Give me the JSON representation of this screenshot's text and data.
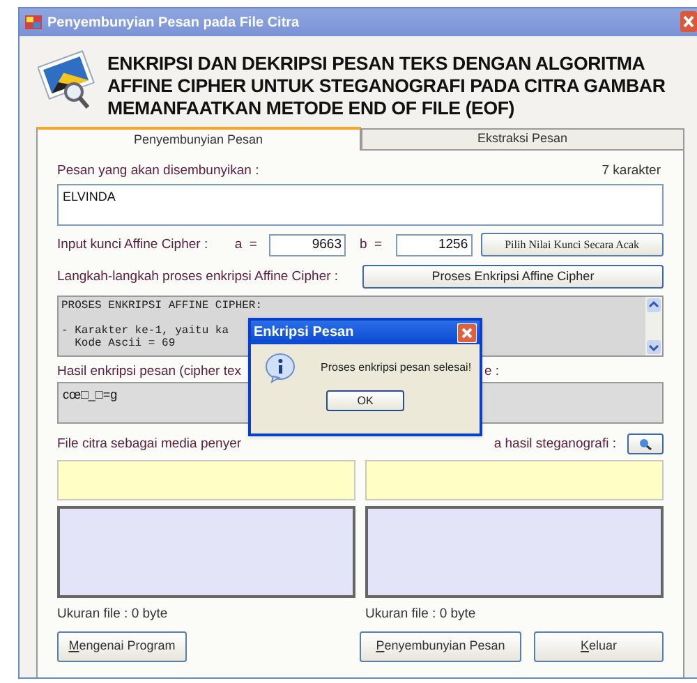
{
  "window": {
    "title": "Penyembunyian Pesan pada File Citra"
  },
  "header": {
    "title": "ENKRIPSI DAN DEKRIPSI PESAN TEKS DENGAN ALGORITMA AFFINE CIPHER UNTUK STEGANOGRAFI PADA CITRA GAMBAR MEMANFAATKAN METODE END OF FILE (EOF)"
  },
  "tabs": [
    {
      "label": "Penyembunyian Pesan",
      "selected": true
    },
    {
      "label": "Ekstraksi Pesan",
      "selected": false
    }
  ],
  "message": {
    "label": "Pesan yang akan disembunyikan :",
    "count": "7 karakter",
    "value": "ELVINDA"
  },
  "keys": {
    "label": "Input kunci Affine Cipher :",
    "a_label": "a  =",
    "a": "9663",
    "b_label": "b  =",
    "b": "1256",
    "random_button": "Pilih Nilai Kunci Secara Acak"
  },
  "steps": {
    "label": "Langkah-langkah proses enkripsi Affine Cipher :",
    "button": "Proses Enkripsi Affine Cipher",
    "lines": [
      "PROSES ENKRIPSI AFFINE CIPHER:",
      "- Karakter ke-1, yaitu ka",
      "  Kode Ascii = 69"
    ]
  },
  "cipher": {
    "label_left": "Hasil enkripsi pesan (cipher tex",
    "label_right": "e :",
    "value": "cœ□_□=g"
  },
  "files": {
    "label_left": "File citra sebagai media penyer",
    "label_right": "a hasil steganografi :",
    "size_left": "Ukuran file : 0 byte",
    "size_right": "Ukuran file : 0 byte"
  },
  "buttons": [
    {
      "label": "Mengenai Program"
    },
    {
      "label": "Penyembunyian Pesan"
    },
    {
      "label": "Keluar"
    }
  ],
  "dialog": {
    "title": "Enkripsi Pesan",
    "message": "Proses enkripsi pesan selesai!",
    "button": "OK"
  }
}
